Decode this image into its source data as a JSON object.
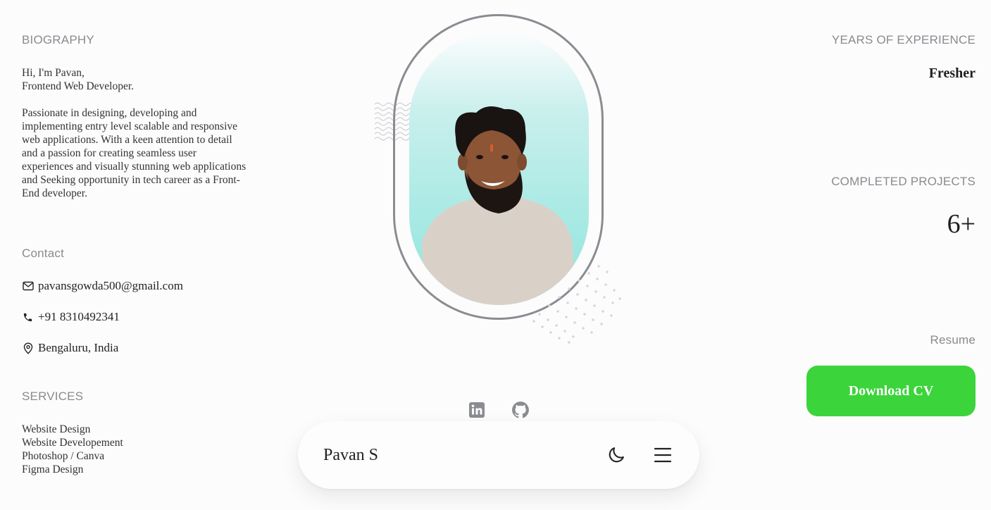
{
  "biography": {
    "title": "BIOGRAPHY",
    "intro_line1": "Hi, I'm Pavan,",
    "intro_line2": "Frontend Web Developer.",
    "body": "Passionate in designing, developing and implementing entry level scalable and responsive web applications. With a keen attention to detail and a passion for creating seamless user experiences and visually stunning web applications and Seeking opportunity in tech career as a Front-End developer."
  },
  "contact": {
    "title": "Contact",
    "email": "pavansgowda500@gmail.com",
    "phone": "+91 8310492341",
    "location": "Bengaluru, India",
    "icons": [
      "mail-icon",
      "phone-icon",
      "location-pin-icon"
    ]
  },
  "services": {
    "title": "SERVICES",
    "items": [
      "Website Design",
      "Website Developement",
      "Photoshop / Canva",
      "Figma Design"
    ]
  },
  "stats": {
    "experience_title": "YEARS OF EXPERIENCE",
    "experience_value": "Fresher",
    "projects_title": "COMPLETED PROJECTS",
    "projects_value": "6+"
  },
  "resume": {
    "title": "Resume",
    "button_label": "Download CV",
    "button_color": "#3bd43b"
  },
  "social": [
    "linkedin-icon",
    "github-icon"
  ],
  "navbar": {
    "brand": "Pavan S",
    "icons": [
      "moon-icon",
      "menu-icon"
    ]
  },
  "colors": {
    "background": "#fcfcfc",
    "muted_text": "#8a8a90",
    "portrait_gradient_bottom": "#8ee5dd",
    "frame_border": "#8b8c92"
  }
}
